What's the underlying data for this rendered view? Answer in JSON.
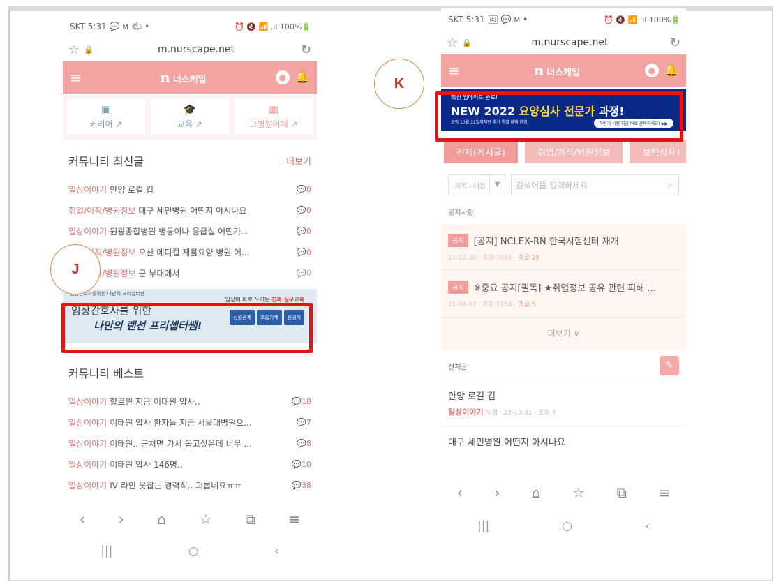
{
  "left": {
    "status": {
      "left": "SKT 5:31 💬 ᴍ 🌤 •",
      "right": "⏰ 🔇 📶 .ıl 100%🔋"
    },
    "url": "m.nurscape.net",
    "brand": "너스케입",
    "quick_nav": [
      {
        "label": "커리어 ↗",
        "icon": "▣"
      },
      {
        "label": "교육 ↗",
        "icon": "🎓"
      },
      {
        "label": "그병원어때 ↗",
        "icon": "▦"
      }
    ],
    "latest": {
      "title": "커뮤니티 최신글",
      "more": "더보기",
      "posts": [
        {
          "cat": "일상이야기",
          "title": "안양 로컬 킵",
          "comments": "💬0"
        },
        {
          "cat": "취업/이직/병원정보",
          "title": "대구 세민병원 어떤지 아시나요",
          "comments": "💬0"
        },
        {
          "cat": "일상이야기",
          "title": "원광종합병원 병동이나 응급실 어떤가...",
          "comments": "💬0"
        },
        {
          "cat": "취업/이직/병원정보",
          "title": "오산 메디컬 재활요양 병원 어...",
          "comments": "💬0"
        },
        {
          "cat": "취업/이직/병원정보",
          "title": "군 부대에서",
          "comments": "💬0"
        }
      ]
    },
    "ad": {
      "tiny": "임상간호사를위한 나만의 프리셉터쌤",
      "line1": "임상간호사를 위한",
      "line2": "나만의 랜선 프리셉터쌤!",
      "right_pre": "임상에 바로 쓰이는",
      "right_hl": "진짜 실무교육",
      "buttons": [
        "심혈관계",
        "호흡기계",
        "신경계"
      ]
    },
    "best": {
      "title": "커뮤니티 베스트",
      "posts": [
        {
          "cat": "일상이야기",
          "title": "할로윈 지금 이태원 압사..",
          "comments": "💬18"
        },
        {
          "cat": "일상이야기",
          "title": "이태원 압사 환자들 지금 서울대병원으...",
          "comments": "💬7"
        },
        {
          "cat": "일상이야기",
          "title": "이태원.. 근처면 가서 돕고싶은데 너무 ...",
          "comments": "💬8"
        },
        {
          "cat": "일상이야기",
          "title": "이태원 압사 146명..",
          "comments": "💬10"
        },
        {
          "cat": "일상이야기",
          "title": "IV 라인 못잡는 경력직.. 괴롭네요ㅠㅠ",
          "comments": "💬38"
        }
      ]
    },
    "bottom_nav": [
      "‹",
      "›",
      "⌂",
      "☆",
      "⧉",
      "≡"
    ],
    "sys_nav": [
      "|||",
      "○",
      "‹"
    ]
  },
  "right": {
    "status": {
      "left": "SKT 5:31 🖼 💬 ᴍ •",
      "right": "⏰ 🔇 📶 .ıl 100%🔋"
    },
    "url": "m.nurscape.net",
    "brand": "너스케입",
    "banner": {
      "small": "최신 업데이트 완료!",
      "main_pre": "NEW 2022 ",
      "main_hl": "요양심사 전문가",
      "main_post": " 과정!",
      "sub": "오직 10월 31일까지만 추가 특별 혜택 한정!",
      "btn": "하반기 시험 지금 바로 준비하세요! ▶▶"
    },
    "tabs": [
      "전체(게시글)",
      "취업/이직/병원정보",
      "보험심사T"
    ],
    "search": {
      "select": "제목+내용",
      "placeholder": "검색어를 입력하세요"
    },
    "notice_label": "공지사항",
    "notices": [
      {
        "badge": "공지",
        "title": "[공지] NCLEX-RN 한국시험센터 재개",
        "meta": "21-12-10 · 조회 7641 · ",
        "comments": "댓글 25"
      },
      {
        "badge": "공지",
        "title": "※중요 공지[필독] ★취업정보 공유 관련 피해 ...",
        "meta": "21-04-07 · 조회 7154 · ",
        "comments": "댓글 5"
      }
    ],
    "notice_more": "더보기 ∨",
    "all_label": "전체글",
    "list": [
      {
        "title": "안양 로컬 킵",
        "cat": "일상이야기",
        "meta": "익명 · 22-10-31 · 조회 7"
      },
      {
        "title": "대구 세민병원 어떤지 아시나요",
        "cat": "",
        "meta": ""
      }
    ],
    "bottom_nav": [
      "‹",
      "›",
      "⌂",
      "☆",
      "⧉",
      "≡"
    ],
    "sys_nav": [
      "|||",
      "○",
      "‹"
    ]
  },
  "callouts": {
    "j": "J",
    "k": "K"
  }
}
